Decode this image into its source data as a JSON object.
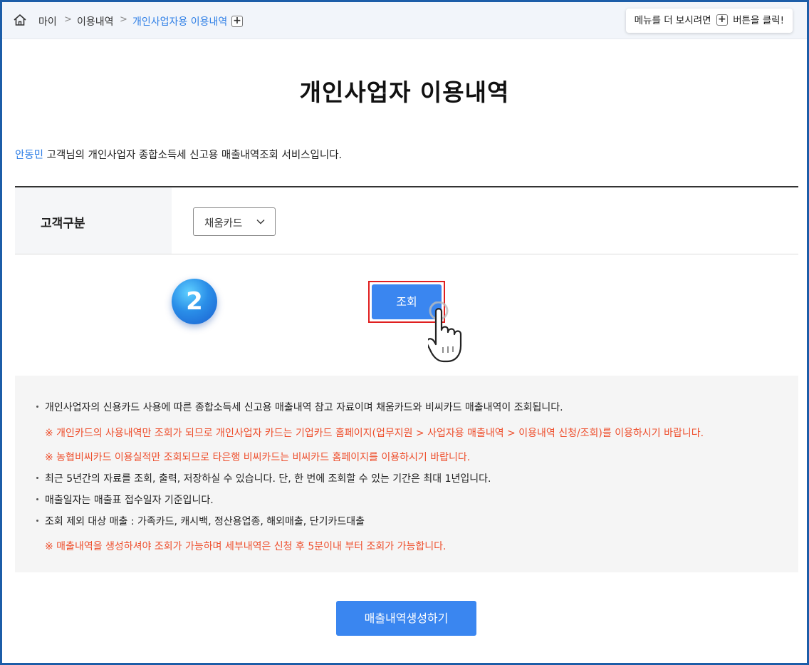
{
  "breadcrumb": {
    "items": [
      "마이",
      "이용내역",
      "개인사업자용 이용내역"
    ],
    "separator": ">",
    "expand_symbol": "+"
  },
  "tip": {
    "prefix": "메뉴를 더 보시려면",
    "plus": "+",
    "suffix": "버튼을 클릭!"
  },
  "page": {
    "title": "개인사업자 이용내역",
    "intro_name": "안동민",
    "intro_text": " 고객님의 개인사업자 종합소득세 신고용 매출내역조회 서비스입니다."
  },
  "form": {
    "label": "고객구분",
    "select_value": "채움카드"
  },
  "step_badge": "2",
  "search_button": "조회",
  "notes": [
    {
      "type": "bullet",
      "text": "개인사업자의 신용카드 사용에 따른 종합소득세 신고용 매출내역 참고 자료이며 채움카드와 비씨카드 매출내역이 조회됩니다."
    },
    {
      "type": "warn",
      "text": "※  개인카드의 사용내역만 조회가 되므로 개인사업자 카드는 기업카드 홈페이지(업무지원 > 사업자용 매출내역 > 이용내역 신청/조회)를 이용하시기 바랍니다."
    },
    {
      "type": "warn",
      "text": "※  농협비씨카드 이용실적만 조회되므로 타은행 비씨카드는 비씨카드 홈페이지를 이용하시기 바랍니다."
    },
    {
      "type": "bullet",
      "text": "최근 5년간의 자료를 조회, 출력, 저장하실 수 있습니다. 단, 한 번에 조회할 수 있는 기간은 최대 1년입니다."
    },
    {
      "type": "bullet",
      "text": "매출일자는 매출표 접수일자 기준입니다."
    },
    {
      "type": "bullet",
      "text": "조회 제외 대상 매출 : 가족카드, 캐시백, 정산용업종, 해외매출, 단기카드대출"
    },
    {
      "type": "warn",
      "text": "※  매출내역을 생성하셔야 조회가 가능하며 세부내역은 신청 후 5분이내 부터 조회가 가능합니다."
    }
  ],
  "generate_button": "매출내역생성하기",
  "icons": {
    "home": "home-icon",
    "select": "chevron-down-icon",
    "cursor": "hand-pointer-icon"
  },
  "colors": {
    "accent": "#3a86f0",
    "link": "#2f7fe6",
    "warning": "#ee4e2c",
    "highlight": "#e01f1f",
    "frame": "#1c5da8"
  }
}
